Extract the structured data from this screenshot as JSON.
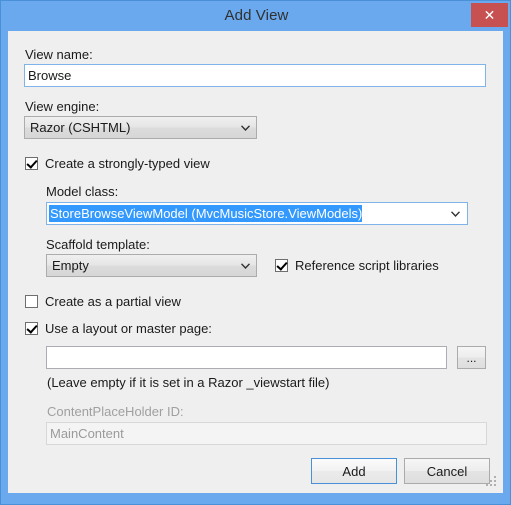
{
  "window": {
    "title": "Add View",
    "close_label": "✕"
  },
  "form": {
    "view_name_label": "View name:",
    "view_name_value": "Browse",
    "view_engine_label": "View engine:",
    "view_engine_value": "Razor (CSHTML)",
    "strongly_typed_label": "Create a strongly-typed view",
    "strongly_typed_checked": true,
    "model_class_label": "Model class:",
    "model_class_value": "StoreBrowseViewModel (MvcMusicStore.ViewModels)",
    "scaffold_template_label": "Scaffold template:",
    "scaffold_template_value": "Empty",
    "reference_scripts_label": "Reference script libraries",
    "reference_scripts_checked": true,
    "partial_view_label": "Create as a partial view",
    "partial_view_checked": false,
    "layout_page_label": "Use a layout or master page:",
    "layout_page_checked": true,
    "layout_path_value": "",
    "browse_button_label": "...",
    "layout_hint": "(Leave empty if it is set in a Razor _viewstart file)",
    "contentplaceholder_label": "ContentPlaceHolder ID:",
    "contentplaceholder_value": "MainContent"
  },
  "buttons": {
    "add_label": "Add",
    "cancel_label": "Cancel"
  },
  "colors": {
    "titlebar": "#6aa9ee",
    "close_button": "#c75050",
    "content_background": "#efefef",
    "selection_highlight": "#3399ff",
    "focus_border": "#7eb4ea"
  }
}
